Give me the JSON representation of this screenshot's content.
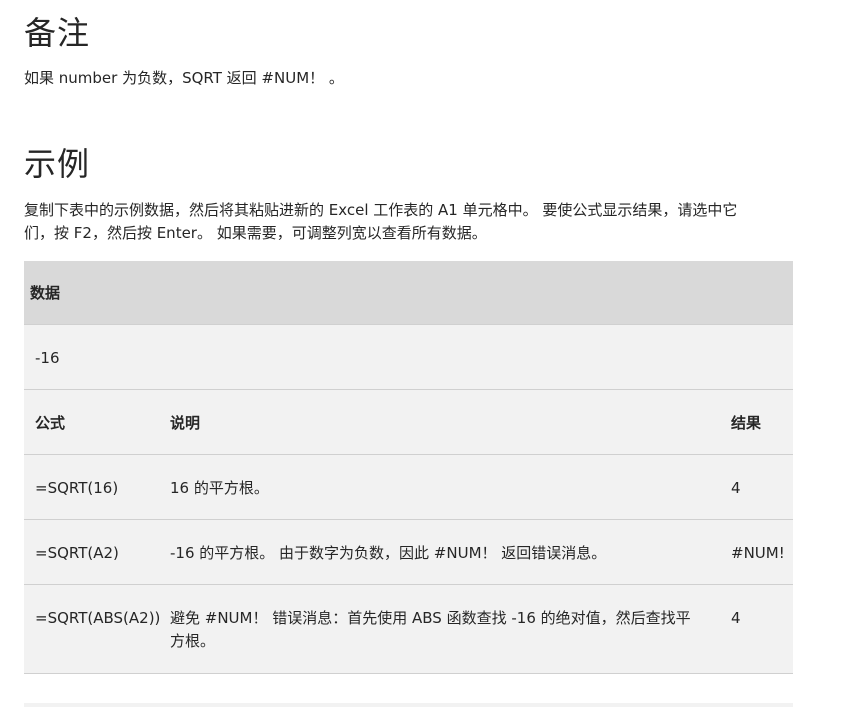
{
  "remarks": {
    "heading": "备注",
    "text": "如果 number 为负数，SQRT 返回 #NUM！ 。"
  },
  "example": {
    "heading": "示例",
    "intro_line1": "复制下表中的示例数据，然后将其粘贴进新的 Excel 工作表的 A1 单元格中。 要使公式显示结果，请选中它",
    "intro_line2": "们，按 F2，然后按 Enter。 如果需要，可调整列宽以查看所有数据。"
  },
  "table": {
    "data_header": "数据",
    "data_value": "-16",
    "columns": [
      "公式",
      "说明",
      "结果"
    ],
    "rows": [
      {
        "formula": "=SQRT(16)",
        "desc_line1": "16 的平方根。",
        "desc_line2": "",
        "result": "4"
      },
      {
        "formula": "=SQRT(A2)",
        "desc_line1": "-16 的平方根。 由于数字为负数，因此 #NUM！ 返回错误消息。",
        "desc_line2": "",
        "result": "#NUM!"
      },
      {
        "formula": "=SQRT(ABS(A2))",
        "desc_line1": "避免 #NUM！ 错误消息：首先使用 ABS 函数查找 -16 的绝对值，然后查找平",
        "desc_line2": "方根。",
        "result": "4"
      }
    ]
  }
}
